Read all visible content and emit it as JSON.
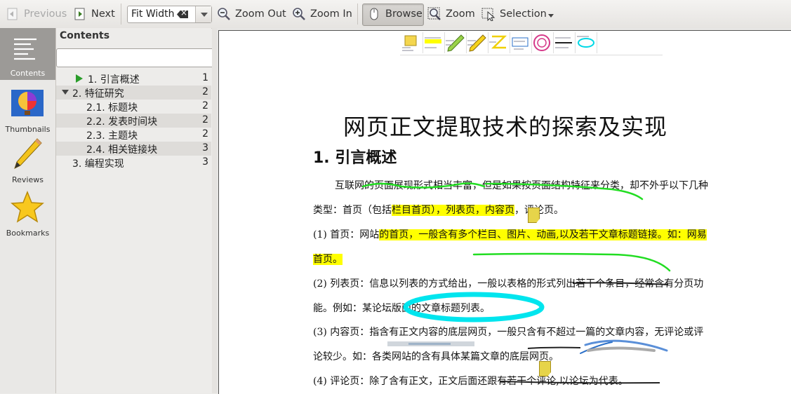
{
  "toolbar": {
    "previous": "Previous",
    "next": "Next",
    "zoom_mode": "Fit Width",
    "zoom_out": "Zoom Out",
    "zoom_in": "Zoom In",
    "browse": "Browse",
    "zoom": "Zoom",
    "selection": "Selection"
  },
  "sidebar": {
    "items": [
      {
        "label": "Contents",
        "icon": "contents-icon"
      },
      {
        "label": "Thumbnails",
        "icon": "balloon-icon"
      },
      {
        "label": "Reviews",
        "icon": "pencil-icon"
      },
      {
        "label": "Bookmarks",
        "icon": "star-icon"
      }
    ]
  },
  "contents": {
    "title": "Contents",
    "search_value": "",
    "entries": [
      {
        "label": "1. 引言概述",
        "page": "1"
      },
      {
        "label": "2. 特征研究",
        "page": "2"
      },
      {
        "label": "2.1. 标题块",
        "page": "2"
      },
      {
        "label": "2.2. 发表时间块",
        "page": "2"
      },
      {
        "label": "2.3. 主题块",
        "page": "2"
      },
      {
        "label": "2.4. 相关链接块",
        "page": "3"
      },
      {
        "label": "3. 编程实现",
        "page": "3"
      }
    ]
  },
  "document": {
    "title": "网页正文提取技术的探索及实现",
    "heading": "1.  引言概述",
    "p1a": "互联网的页面展现形式相当丰富，但是如果按页面结构特征来分类，却不外乎以下几种",
    "p1b_pre": "类型：首页（包括",
    "p1b_hl": "栏目首页），列表页，内容页",
    "p1b_post": "，评论页。",
    "p2a_pre": "(1) 首页：网站",
    "p2a_hl": "的首页，一般含有多个栏目、图片、动画,以及若干文章标题链接。如：网易",
    "p2b_hl": "首页。",
    "p3a": "(2) 列表页：信息以列表的方式给出，一般以表格的形式列出若干个条目，经常含有分页功",
    "p3b": "能。例如：某论坛版面的文章标题列表。",
    "p4a": "(3) 内容页：指含有正文内容的底层网页，一般只含有不超过一篇的文章内容，无评论或评",
    "p4b": "论较少。如：各类网站的含有具体某篇文章的底层网页。",
    "p5a": "(4) 评论页：除了含有正文，正文后面还跟有若干个评论,以论坛为代表。"
  },
  "colors": {
    "highlight": "#ffff00",
    "green_ink": "#22dd22",
    "cyan_ink": "#00e5ee",
    "note": "#e6d44a"
  }
}
